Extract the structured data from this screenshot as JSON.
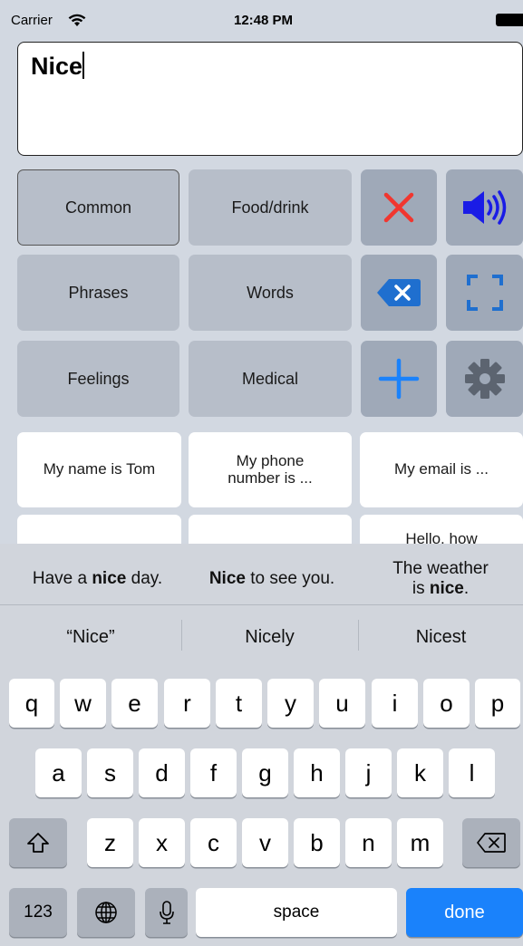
{
  "status_bar": {
    "carrier": "Carrier",
    "time": "12:48 PM"
  },
  "text_box": {
    "value": "Nice"
  },
  "categories": [
    "Common",
    "Food/drink",
    "Phrases",
    "Words",
    "Feelings",
    "Medical"
  ],
  "selected_category": "Common",
  "action_icons": [
    "clear-x-icon",
    "speaker-icon",
    "backspace-icon",
    "fullscreen-icon",
    "add-icon",
    "gear-icon"
  ],
  "colors": {
    "clear": "#f1362f",
    "accent": "#1a82fb",
    "gear": "#5c6470",
    "speaker": "#1a1ce6"
  },
  "phrases": {
    "p1": "My name is Tom",
    "p2_line1": "My phone",
    "p2_line2": "number is ...",
    "p3": "My email is ...",
    "p6_partial": "Hello, how"
  },
  "predictions": {
    "p1": {
      "pre": "Have a ",
      "bold": "nice",
      "post": " day."
    },
    "p2": {
      "pre": "",
      "bold": "Nice",
      "post": " to see you."
    },
    "p3": {
      "line1": "The weather",
      "pre2": "is ",
      "bold": "nice",
      "post": "."
    }
  },
  "suggestions": [
    "“Nice”",
    "Nicely",
    "Nicest"
  ],
  "keyboard": {
    "row1": [
      "q",
      "w",
      "e",
      "r",
      "t",
      "y",
      "u",
      "i",
      "o",
      "p"
    ],
    "row2": [
      "a",
      "s",
      "d",
      "f",
      "g",
      "h",
      "j",
      "k",
      "l"
    ],
    "row3": [
      "z",
      "x",
      "c",
      "v",
      "b",
      "n",
      "m"
    ],
    "numbers": "123",
    "space": "space",
    "done": "done"
  }
}
